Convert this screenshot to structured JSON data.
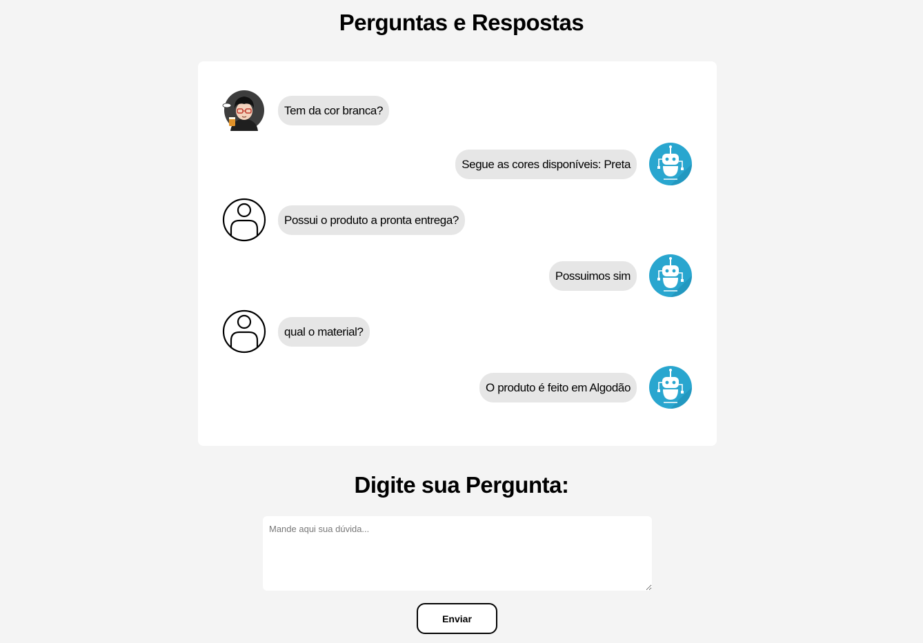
{
  "page": {
    "title": "Perguntas e Respostas",
    "ask_title": "Digite sua Pergunta:"
  },
  "messages": [
    {
      "role": "user",
      "avatar": "cartoon-user-avatar",
      "text": "Tem da cor branca?"
    },
    {
      "role": "bot",
      "avatar": "robot-avatar",
      "text": "Segue as cores disponíveis: Preta"
    },
    {
      "role": "user",
      "avatar": "user-outline-icon",
      "text": "Possui o produto a pronta entrega?"
    },
    {
      "role": "bot",
      "avatar": "robot-avatar",
      "text": "Possuimos sim"
    },
    {
      "role": "user",
      "avatar": "user-outline-icon",
      "text": "qual o material?"
    },
    {
      "role": "bot",
      "avatar": "robot-avatar",
      "text": "O produto é feito em Algodão"
    }
  ],
  "form": {
    "placeholder": "Mande aqui sua dúvida...",
    "value": "",
    "send_label": "Enviar"
  },
  "colors": {
    "background": "#f4f4f4",
    "card": "#ffffff",
    "bubble": "#e6e6e6",
    "bot_avatar": "#29a6cf"
  }
}
